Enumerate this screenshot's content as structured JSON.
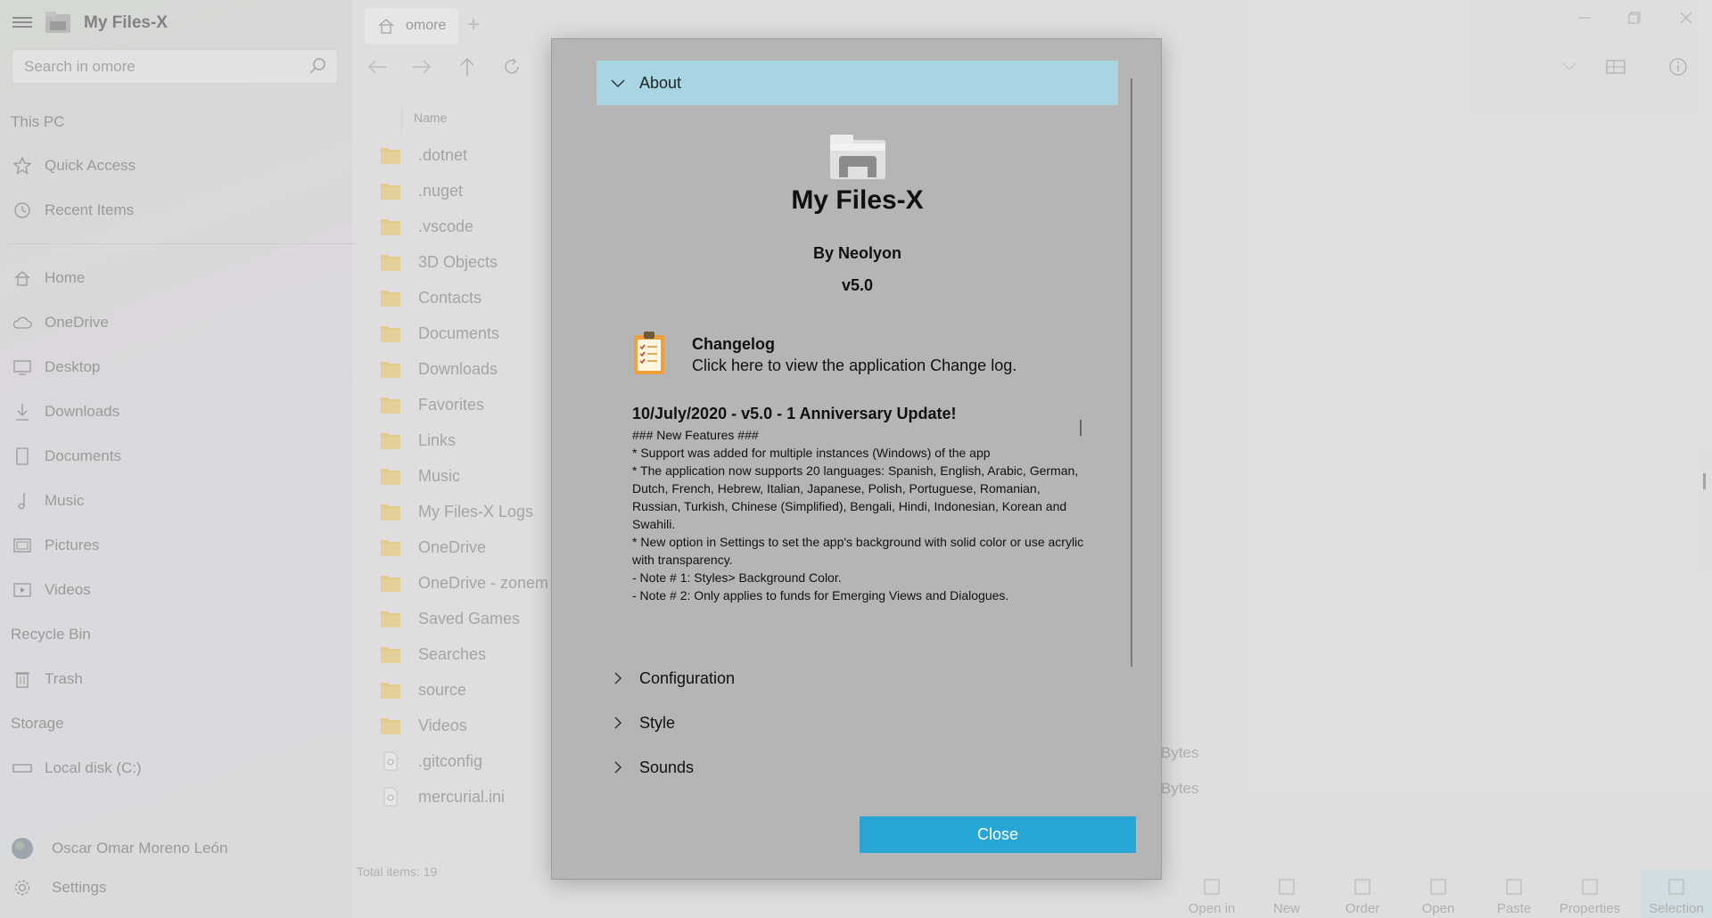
{
  "app": {
    "title": "My Files-X"
  },
  "search": {
    "placeholder": "Search in omore"
  },
  "sidebar": {
    "this_pc": "This PC",
    "quick_access": "Quick Access",
    "recent_items": "Recent Items",
    "items": [
      {
        "label": "Home",
        "icon": "home-icon"
      },
      {
        "label": "OneDrive",
        "icon": "cloud-icon"
      },
      {
        "label": "Desktop",
        "icon": "desktop-icon"
      },
      {
        "label": "Downloads",
        "icon": "download-icon"
      },
      {
        "label": "Documents",
        "icon": "document-icon"
      },
      {
        "label": "Music",
        "icon": "music-icon"
      },
      {
        "label": "Pictures",
        "icon": "picture-icon"
      },
      {
        "label": "Videos",
        "icon": "video-icon"
      }
    ],
    "recycle_bin": "Recycle Bin",
    "trash": "Trash",
    "storage": "Storage",
    "local_disk": "Local disk (C:)",
    "user_name": "Oscar Omar Moreno León",
    "settings": "Settings"
  },
  "tab": {
    "label": "omore"
  },
  "file_list": {
    "header": "Name",
    "files": [
      {
        "name": ".dotnet",
        "type": "folder"
      },
      {
        "name": ".nuget",
        "type": "folder"
      },
      {
        "name": ".vscode",
        "type": "folder"
      },
      {
        "name": "3D Objects",
        "type": "folder"
      },
      {
        "name": "Contacts",
        "type": "folder"
      },
      {
        "name": "Documents",
        "type": "folder"
      },
      {
        "name": "Downloads",
        "type": "folder"
      },
      {
        "name": "Favorites",
        "type": "folder"
      },
      {
        "name": "Links",
        "type": "folder"
      },
      {
        "name": "Music",
        "type": "folder"
      },
      {
        "name": "My Files-X Logs",
        "type": "folder"
      },
      {
        "name": "OneDrive",
        "type": "folder"
      },
      {
        "name": "OneDrive - zonem",
        "type": "folder"
      },
      {
        "name": "Saved Games",
        "type": "folder"
      },
      {
        "name": "Searches",
        "type": "folder"
      },
      {
        "name": "source",
        "type": "folder"
      },
      {
        "name": "Videos",
        "type": "folder"
      },
      {
        "name": ".gitconfig",
        "type": "file"
      },
      {
        "name": "mercurial.ini",
        "type": "file"
      }
    ],
    "bytes_label": "Bytes",
    "total": "Total items: 19"
  },
  "commands": [
    {
      "label": "Open in",
      "icon": "open-in-icon"
    },
    {
      "label": "New",
      "icon": "plus-icon"
    },
    {
      "label": "Order",
      "icon": "more-icon"
    },
    {
      "label": "Open",
      "icon": "open-icon"
    },
    {
      "label": "Paste",
      "icon": "paste-icon"
    },
    {
      "label": "Properties",
      "icon": "info-icon"
    },
    {
      "label": "Selection",
      "icon": "selection-icon"
    }
  ],
  "dialog": {
    "about_header": "About",
    "app_name": "My Files-X",
    "author": "By Neolyon",
    "version": "v5.0",
    "changelog_title": "Changelog",
    "changelog_subtitle": "Click here to view the application Change log.",
    "notes_heading": "10/July/2020 - v5.0 - 1 Anniversary Update!",
    "notes_body": "### New Features ###\n* Support was added for multiple instances (Windows) of the app\n* The application now supports 20 languages: Spanish, English, Arabic, German, Dutch, French, Hebrew, Italian, Japanese, Polish, Portuguese, Romanian, Russian, Turkish, Chinese (Simplified), Bengali, Hindi, Indonesian, Korean and Swahili.\n* New option in Settings to set the app's background with solid color or use acrylic with transparency.\n- Note # 1: Styles> Background Color.\n- Note # 2: Only applies to funds for Emerging Views and Dialogues.",
    "sections": [
      "Configuration",
      "Style",
      "Sounds"
    ],
    "close_label": "Close"
  },
  "colors": {
    "accent": "#27a6d5",
    "about_header_bg": "#a8d5e2",
    "dialog_bg": "#b5b5b5",
    "folder": "#f3d178"
  }
}
